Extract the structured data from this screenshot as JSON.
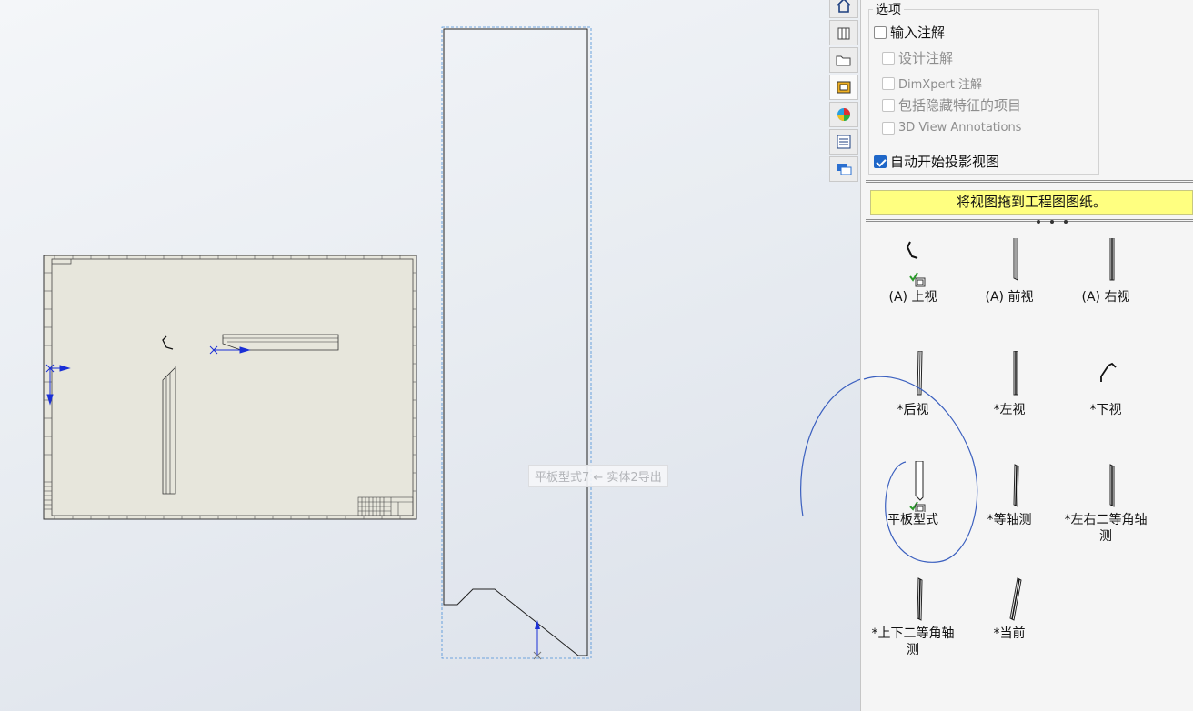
{
  "tooltip": "平板型式7 ← 实体2导出",
  "toolbar_tabs": [
    "home-icon",
    "parts-icon",
    "folder-icon",
    "view-palette-icon",
    "appearance-icon",
    "properties-icon",
    "feedback-icon"
  ],
  "options": {
    "legend": "选项",
    "import_annotations": {
      "label": "输入注解",
      "checked": false
    },
    "design_annotations": {
      "label": "设计注解",
      "checked": false
    },
    "dimxpert_annotations": {
      "label": "DimXpert 注解",
      "checked": false
    },
    "hidden_features": {
      "label": "包括隐藏特征的项目",
      "checked": false
    },
    "view_3d_annotations": {
      "label": "3D View Annotations",
      "checked": false
    },
    "auto_projected_view": {
      "label": "自动开始投影视图",
      "checked": true
    }
  },
  "banner": "将视图拖到工程图图纸。",
  "views": [
    {
      "label": "(A) 上视"
    },
    {
      "label": "(A) 前视"
    },
    {
      "label": "(A) 右视"
    },
    {
      "label": "*后视"
    },
    {
      "label": "*左视"
    },
    {
      "label": "*下视"
    },
    {
      "label": "平板型式"
    },
    {
      "label": "*等轴测"
    },
    {
      "label": "*左右二等角轴"
    },
    {
      "label": "测"
    },
    {
      "label": "*上下二等角轴"
    },
    {
      "label": "测"
    },
    {
      "label": "*当前"
    }
  ],
  "colors": {
    "accent": "#1f67c8",
    "banner": "#ffff80",
    "sheet": "#e7e6dc",
    "annotation_ink": "#3a5fbf"
  }
}
